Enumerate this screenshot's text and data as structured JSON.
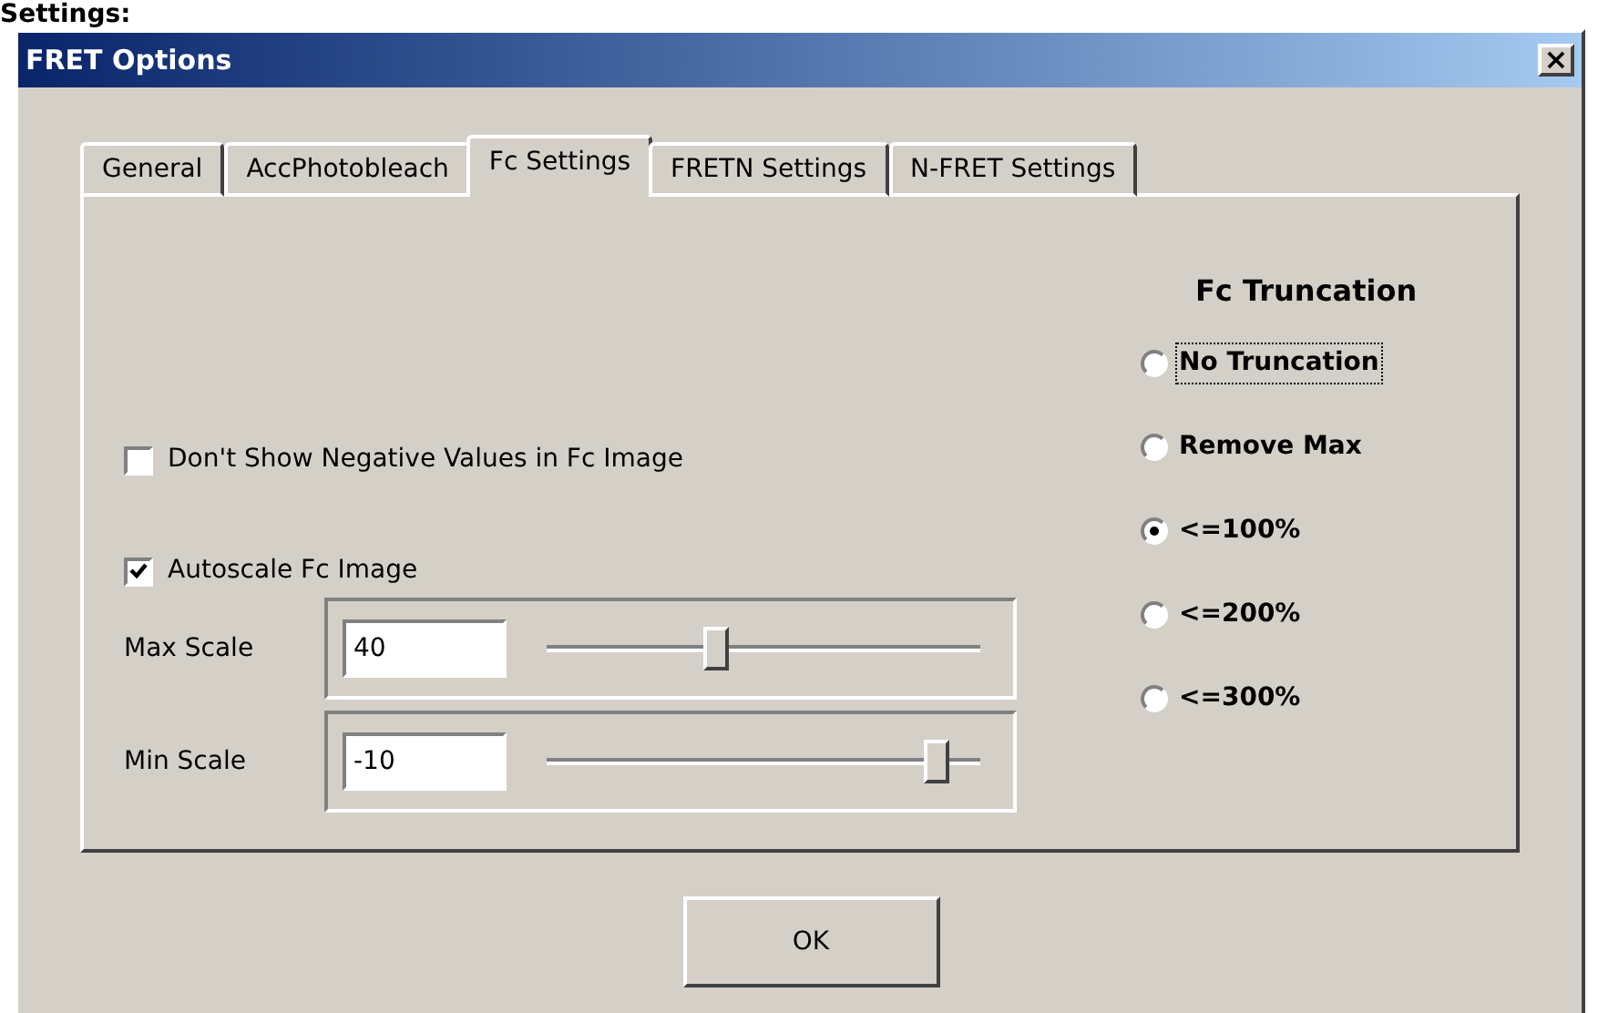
{
  "caption": "Settings:",
  "window": {
    "title": "FRET Options",
    "close": "×"
  },
  "tabs": [
    {
      "label": "General",
      "selected": false
    },
    {
      "label": "AccPhotobleach",
      "selected": false
    },
    {
      "label": "Fc Settings",
      "selected": true
    },
    {
      "label": "FRETN Settings",
      "selected": false
    },
    {
      "label": "N-FRET Settings",
      "selected": false
    }
  ],
  "checkboxes": [
    {
      "label": "Don't Show Negative Values in Fc Image",
      "checked": false
    },
    {
      "label": "Autoscale Fc Image",
      "checked": true
    }
  ],
  "scales": [
    {
      "label": "Max Scale",
      "value": "40",
      "level": 0.39
    },
    {
      "label": "Min Scale",
      "value": "-10",
      "level": 0.9
    }
  ],
  "truncation": {
    "title": "Fc Truncation",
    "options": [
      {
        "label": "No Truncation",
        "selected": false,
        "focused": true
      },
      {
        "label": "Remove Max",
        "selected": false,
        "focused": false
      },
      {
        "label": "<=100%",
        "selected": true,
        "focused": false
      },
      {
        "label": "<=200%",
        "selected": false,
        "focused": false
      },
      {
        "label": "<=300%",
        "selected": false,
        "focused": false
      }
    ]
  },
  "ok_button": "OK"
}
